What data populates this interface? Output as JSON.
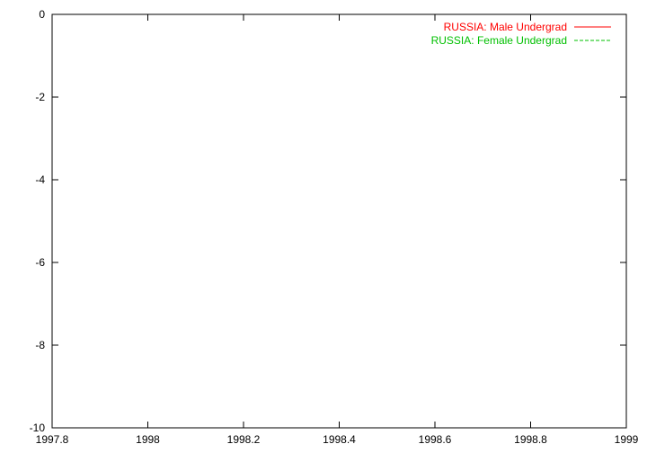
{
  "chart_data": {
    "type": "line",
    "xlim": [
      1997.8,
      1999
    ],
    "ylim": [
      -10,
      0
    ],
    "xticks": [
      "1997.8",
      "1998",
      "1998.2",
      "1998.4",
      "1998.6",
      "1998.8",
      "1999"
    ],
    "yticks": [
      "0",
      "-2",
      "-4",
      "-6",
      "-8",
      "-10"
    ],
    "grid": false,
    "legend_position": "top-right",
    "series": [
      {
        "name": "RUSSIA: Male Undergrad",
        "color": "#ff0000",
        "dash": "solid",
        "x": [
          1998,
          1999
        ],
        "y": [
          0,
          0
        ]
      },
      {
        "name": "RUSSIA: Female Undergrad",
        "color": "#00c000",
        "dash": "dashed",
        "x": [
          1998,
          1999
        ],
        "y": [
          0,
          0
        ]
      }
    ]
  }
}
